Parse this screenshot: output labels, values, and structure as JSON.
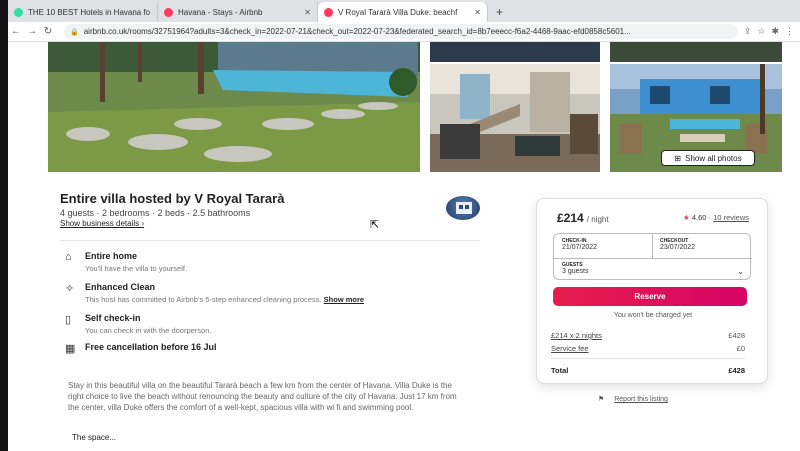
{
  "browser": {
    "tabs": [
      {
        "title": "THE 10 BEST Hotels in Havana fo",
        "favicon_color": "#34e0a1",
        "active": false
      },
      {
        "title": "Havana - Stays - Airbnb",
        "favicon_color": "#ff385c",
        "active": false
      },
      {
        "title": "V Royal Tararà Villa Duke: beachf",
        "favicon_color": "#ff385c",
        "active": true
      }
    ],
    "url": "airbnb.co.uk/rooms/32751964?adults=3&check_in=2022-07-21&check_out=2022-07-23&federated_search_id=8b7eeecc-f6a2-4468-9aac-efd0858c5601..."
  },
  "gallery": {
    "show_all_label": "Show all photos"
  },
  "host": {
    "title": "Entire villa hosted by V Royal Tararà",
    "summary": "4 guests · 2 bedrooms · 2 beds · 2.5 bathrooms",
    "business_link": "Show business details"
  },
  "features": [
    {
      "icon": "home-icon",
      "title": "Entire home",
      "desc": "You'll have the villa to yourself.",
      "link": ""
    },
    {
      "icon": "sparkle-icon",
      "title": "Enhanced Clean",
      "desc": "This host has committed to Airbnb's 5-step enhanced cleaning process.",
      "link": "Show more"
    },
    {
      "icon": "door-icon",
      "title": "Self check-in",
      "desc": "You can check in with the doorperson.",
      "link": ""
    },
    {
      "icon": "calendar-icon",
      "title": "Free cancellation before 16 Jul",
      "desc": "",
      "link": ""
    }
  ],
  "description": "Stay in this beautiful villa on the beautiful Tararà beach a few km from the center of Havana. Villa Duke is the right choice to live the beach without renouncing the beauty and culture of the city of Havana. Just 17 km from the center, villa Duke offers the comfort of a well-kept, spacious villa with wi fi and swimming pool.",
  "space_link": "The space...",
  "booking": {
    "price": "£214",
    "per": "/ night",
    "rating": "4.60",
    "reviews": "10 reviews",
    "checkin_label": "CHECK-IN",
    "checkin": "21/07/2022",
    "checkout_label": "CHECKOUT",
    "checkout": "23/07/2022",
    "guests_label": "GUESTS",
    "guests": "3 guests",
    "reserve": "Reserve",
    "no_charge": "You won't be charged yet",
    "line1_label": "£214 x 2 nights",
    "line1_value": "£428",
    "line2_label": "Service fee",
    "line2_value": "£0",
    "total_label": "Total",
    "total_value": "£428"
  },
  "report_link": "Report this listing",
  "colors": {
    "accent": "#e61e4d",
    "star": "#e0434f"
  }
}
